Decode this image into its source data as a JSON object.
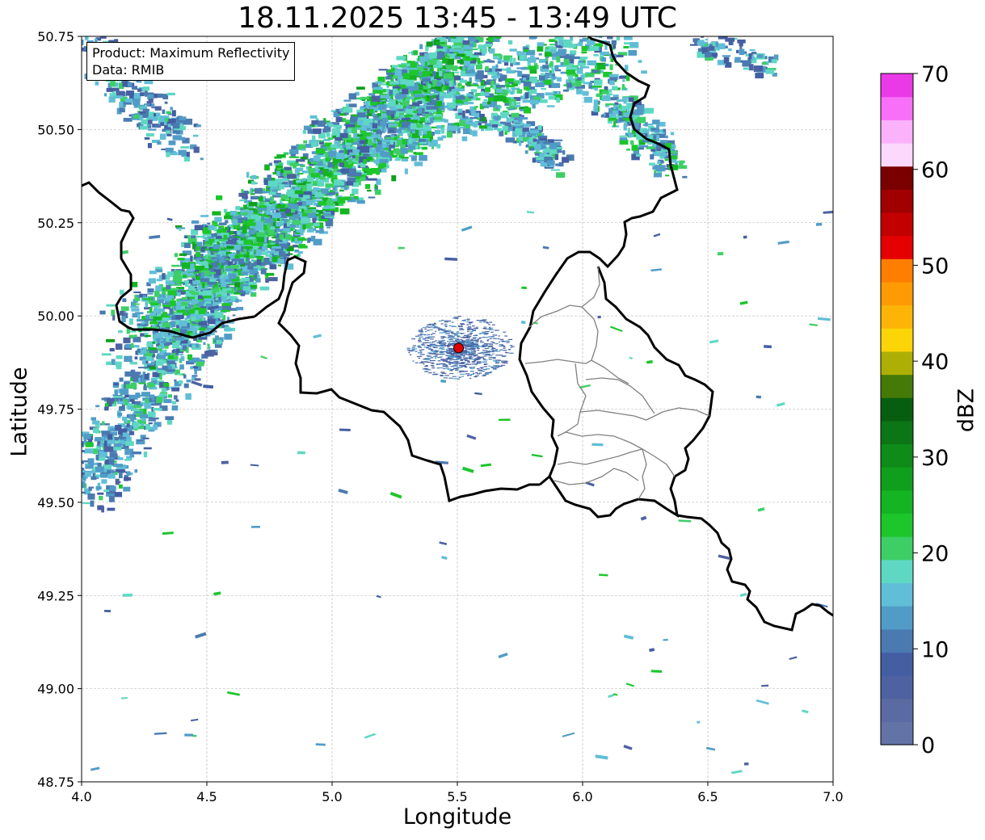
{
  "title": "18.11.2025 13:45 - 13:49 UTC",
  "info_box": {
    "product": "Product: Maximum Reflectivity",
    "data": "Data: RMIB"
  },
  "x_axis": {
    "label": "Longitude",
    "range": [
      4.0,
      7.0
    ],
    "ticks": [
      "4.0",
      "4.5",
      "5.0",
      "5.5",
      "6.0",
      "6.5",
      "7.0"
    ]
  },
  "y_axis": {
    "label": "Latitude",
    "range": [
      48.75,
      50.75
    ],
    "ticks": [
      "48.75",
      "49.00",
      "49.25",
      "49.50",
      "49.75",
      "50.00",
      "50.25",
      "50.50",
      "50.75"
    ]
  },
  "colorbar": {
    "label": "dBZ",
    "range": [
      0,
      70
    ],
    "ticks": [
      "0",
      "10",
      "20",
      "30",
      "40",
      "50",
      "60",
      "70"
    ],
    "colors": [
      "#6373a6",
      "#5a6ba3",
      "#4e62a2",
      "#445ea2",
      "#4a7ab0",
      "#519cc7",
      "#60bed7",
      "#5fd8c3",
      "#3dcf66",
      "#1dc62b",
      "#14b423",
      "#109f1c",
      "#0e8b18",
      "#0c7515",
      "#085e10",
      "#467a08",
      "#adaf05",
      "#fbd507",
      "#fcb506",
      "#fd9a04",
      "#fd7e00",
      "#e40000",
      "#c20000",
      "#a00000",
      "#7a0000",
      "#fcd8fc",
      "#fbb2fb",
      "#f86ff8",
      "#ea3ae8"
    ]
  },
  "radar_site": {
    "lon": 5.505,
    "lat": 49.914,
    "color": "#e00000"
  },
  "grid": true
}
